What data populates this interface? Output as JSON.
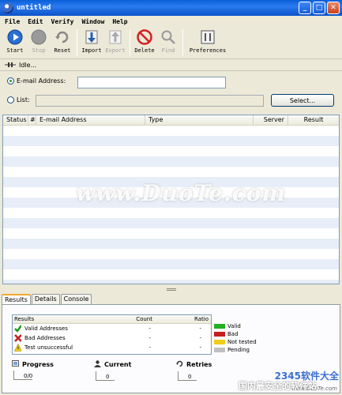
{
  "window": {
    "title": "untitled"
  },
  "menu": [
    "File",
    "Edit",
    "Verify",
    "Window",
    "Help"
  ],
  "toolbar": [
    {
      "label": "Start",
      "icon": "play-icon",
      "enabled": true
    },
    {
      "label": "Stop",
      "icon": "stop-icon",
      "enabled": false
    },
    {
      "label": "Reset",
      "icon": "reset-icon",
      "enabled": true
    },
    {
      "label": "Import",
      "icon": "import-icon",
      "enabled": true
    },
    {
      "label": "Export",
      "icon": "export-icon",
      "enabled": false
    },
    {
      "label": "Delete",
      "icon": "delete-icon",
      "enabled": true
    },
    {
      "label": "Find",
      "icon": "find-icon",
      "enabled": false
    },
    {
      "label": "Preferences",
      "icon": "preferences-icon",
      "enabled": true
    }
  ],
  "status": {
    "text": "Idle..."
  },
  "input": {
    "email_label": "E-mail Address:",
    "email_value": "",
    "list_label": "List:",
    "list_value": "",
    "select_label": "Select..."
  },
  "table": {
    "columns": [
      "Status",
      "#",
      "E-mail Address",
      "Type",
      "Server",
      "Result"
    ],
    "rows": []
  },
  "watermark": "www.DuoTe.com",
  "tabs": [
    "Results",
    "Details",
    "Console"
  ],
  "results": {
    "headers": [
      "Results",
      "Count",
      "Ratio"
    ],
    "rows": [
      {
        "name": "Valid Addresses",
        "count": "-",
        "ratio": "-",
        "icon": "check-icon"
      },
      {
        "name": "Bad Addresses",
        "count": "-",
        "ratio": "-",
        "icon": "x-icon"
      },
      {
        "name": "Test unsuccessful",
        "count": "-",
        "ratio": "-",
        "icon": "warning-icon"
      }
    ]
  },
  "legend": [
    {
      "label": "Valid",
      "color": "#22b022"
    },
    {
      "label": "Bad",
      "color": "#c81e1e"
    },
    {
      "label": "Not tested",
      "color": "#f2cc1a"
    },
    {
      "label": "Pending",
      "color": "#c0c0c0"
    }
  ],
  "stats": {
    "progress_label": "Progress",
    "progress_value": "0/0",
    "current_label": "Current",
    "current_value": "0",
    "retries_label": "Retries",
    "retries_value": "0"
  },
  "corner_watermark": {
    "brand": "2345软件大全",
    "url": "www.DuoTe.com",
    "site": "国内最安全的软件站"
  }
}
